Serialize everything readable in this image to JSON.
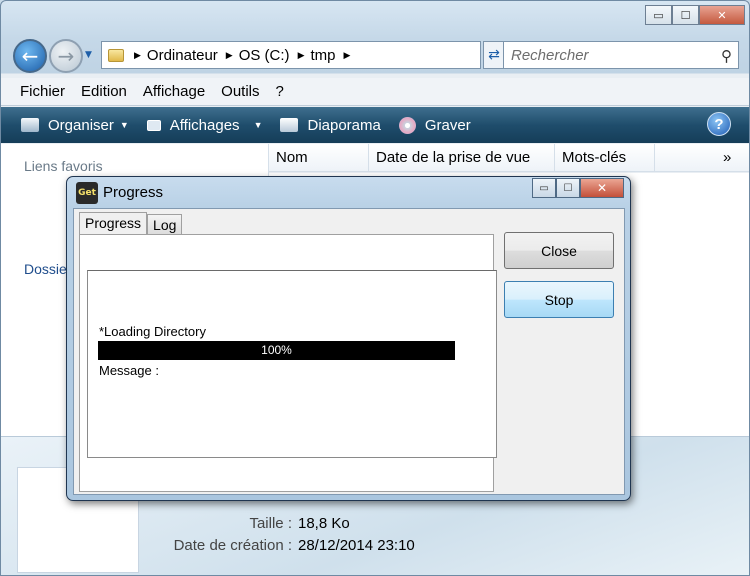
{
  "explorer": {
    "caption": {
      "minimize": "▭",
      "maximize": "☐",
      "close": "✕"
    },
    "address": {
      "segments": [
        "Ordinateur",
        "OS (C:)",
        "tmp"
      ]
    },
    "search_placeholder": "Rechercher",
    "menu": [
      "Fichier",
      "Edition",
      "Affichage",
      "Outils",
      "?"
    ],
    "toolbar": {
      "organiser": "Organiser",
      "affichages": "Affichages",
      "diaporama": "Diaporama",
      "graver": "Graver"
    },
    "navpane": {
      "favorites_header": "Liens favoris",
      "folders_header": "Dossie"
    },
    "columns": [
      "Nom",
      "Date de la prise de vue",
      "Mots-clés"
    ],
    "details": {
      "size_label": "Taille :",
      "size_value": "18,8 Ko",
      "created_label": "Date de création :",
      "created_value": "28/12/2014 23:10"
    }
  },
  "dialog": {
    "title": "Progress",
    "icon_text": "Get",
    "tabs": [
      "Progress",
      "Log"
    ],
    "status_text": "*Loading Directory",
    "progress": {
      "percent": 100,
      "label": "100%"
    },
    "message_label": "Message :",
    "buttons": {
      "close": "Close",
      "stop": "Stop"
    }
  }
}
